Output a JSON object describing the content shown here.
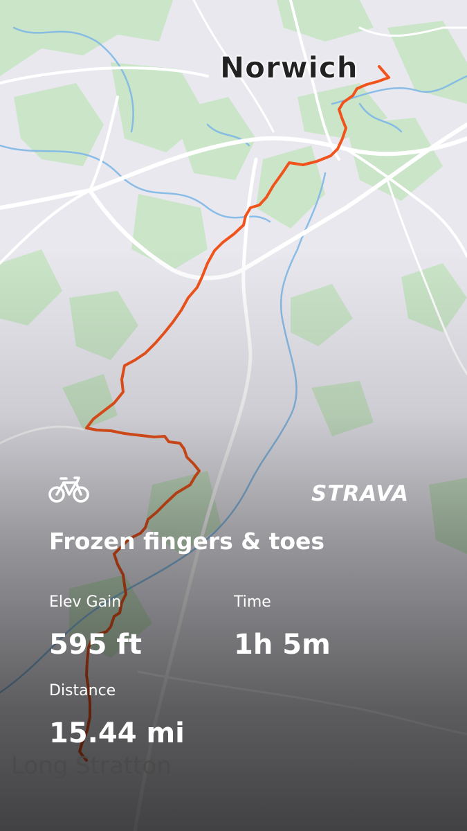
{
  "map": {
    "places": {
      "north": "Norwich",
      "south": "Long Stratton"
    },
    "colors": {
      "route": "#f0541c",
      "water": "#7fb8e6",
      "green": "#c9e5c6",
      "road": "#ffffff",
      "land": "#e9e8ef"
    }
  },
  "activity": {
    "sport_icon": "bike-icon",
    "brand_logo": "STRAVA",
    "title": "Frozen fingers & toes",
    "stats": {
      "elev_gain": {
        "label": "Elev Gain",
        "value": "595 ft"
      },
      "time": {
        "label": "Time",
        "value": "1h 5m"
      },
      "distance": {
        "label": "Distance",
        "value": "15.44 mi"
      }
    }
  }
}
